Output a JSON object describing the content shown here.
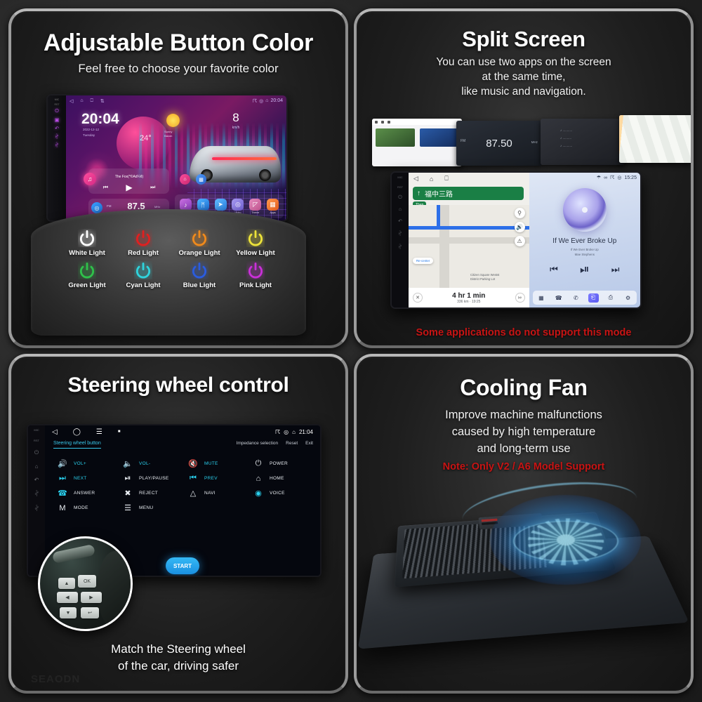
{
  "panels": {
    "button_color": {
      "title": "Adjustable Button Color",
      "subtitle": "Feel free to choose your favorite color",
      "head_unit": {
        "side_labels": [
          "MIC",
          "RST"
        ],
        "status_time": "20:04",
        "clock": "20:04",
        "date": "2022-12-12",
        "weekday": "Tuesday",
        "temperature": "24°",
        "weather": "Sunny",
        "weather_sub": "Bacan",
        "speed": "8",
        "speed_unit": "km/h",
        "music_title": "The Fox(*©Ad¼¢)",
        "radio_band": "FM",
        "radio_freq": "87.5",
        "radio_unit": "MHz",
        "dock": [
          {
            "label": "Music",
            "icon": "music-icon",
            "glyph": "♪",
            "color": "#b65bd6"
          },
          {
            "label": "Bluetooth",
            "icon": "bluetooth-icon",
            "glyph": "ᛗ",
            "color": "#2e9bf0"
          },
          {
            "label": "Navi",
            "icon": "navigation-icon",
            "glyph": "➤",
            "color": "#3fa9f5"
          },
          {
            "label": "Video",
            "icon": "video-icon",
            "glyph": "◎",
            "color": "#8f7ee8"
          },
          {
            "label": "Theme",
            "icon": "theme-icon",
            "glyph": "◰",
            "color": "#d46fa8"
          },
          {
            "label": "Apps",
            "icon": "apps-icon",
            "glyph": "☰",
            "color": "#f07a3c"
          }
        ]
      },
      "lights": [
        {
          "label": "White Light",
          "color": "#ffffff"
        },
        {
          "label": "Red Light",
          "color": "#e02020"
        },
        {
          "label": "Orange Light",
          "color": "#f08a1c"
        },
        {
          "label": "Yellow Light",
          "color": "#ece23a"
        },
        {
          "label": "Green Light",
          "color": "#2fc14a"
        },
        {
          "label": "Cyan Light",
          "color": "#2fd4dd"
        },
        {
          "label": "Blue Light",
          "color": "#2a5ce0"
        },
        {
          "label": "Pink Light",
          "color": "#c930d8"
        }
      ]
    },
    "split_screen": {
      "title": "Split Screen",
      "subtitle_lines": [
        "You can use two apps on the screen",
        "at the same time,",
        "like music and navigation."
      ],
      "warning": "Some applications do not support this mode",
      "collage_radio_freq": "87.50",
      "collage_radio_band": "FM",
      "collage_radio_unit": "MHz",
      "device": {
        "status_time": "15:25",
        "nav_street": "福中三路",
        "nav_then": "Then",
        "nav_poi_1": "Citizen Square Westst",
        "nav_poi_2": "District Parking Lot",
        "eta_time": "4 hr 1 min",
        "eta_sub": "336 km · 19:25",
        "recenter": "Re-center",
        "music_title": "If We Ever Broke Up",
        "music_sub1": "If We Ever Broke Up",
        "music_sub2": "Mae Stephens"
      }
    },
    "steering": {
      "title": "Steering wheel control",
      "caption_lines": [
        "Match the Steering wheel",
        "of the car, driving safer"
      ],
      "status_time": "21:04",
      "tab": "Steering wheel button",
      "tools": [
        "Impedance selection",
        "Reset",
        "Exit"
      ],
      "start_label": "START",
      "buttons": [
        {
          "label": "VOL+",
          "glyph": "⧺",
          "color": "cyan"
        },
        {
          "label": "VOL-",
          "glyph": "⧺",
          "color": "cyan"
        },
        {
          "label": "MUTE",
          "glyph": "⧺",
          "color": "cyan"
        },
        {
          "label": "POWER",
          "glyph": "⏻",
          "color": "white"
        },
        {
          "label": "NEXT",
          "glyph": "⏭",
          "color": "cyan"
        },
        {
          "label": "PLAY/PAUSE",
          "glyph": "⏯",
          "color": "white"
        },
        {
          "label": "PREV",
          "glyph": "⏮",
          "color": "cyan"
        },
        {
          "label": "HOME",
          "glyph": "⌂",
          "color": "white"
        },
        {
          "label": "ANSWER",
          "glyph": "✆",
          "color": "cyan"
        },
        {
          "label": "REJECT",
          "glyph": "✕",
          "color": "white"
        },
        {
          "label": "NAVI",
          "glyph": "△",
          "color": "white"
        },
        {
          "label": "VOICE",
          "glyph": "◉",
          "color": "cyan"
        },
        {
          "label": "MODE",
          "glyph": "M",
          "color": "white"
        },
        {
          "label": "MENU",
          "glyph": "☰",
          "color": "white"
        }
      ],
      "wheel_keys": [
        "OK",
        "▲",
        "◀",
        "▶",
        "▼",
        "↩"
      ],
      "watermark": "SEAODN"
    },
    "cooling_fan": {
      "title": "Cooling Fan",
      "subtitle_lines": [
        "Improve machine malfunctions",
        "caused by high temperature",
        "and long-term use"
      ],
      "note": "Note: Only V2 / A6 Model Support"
    }
  }
}
